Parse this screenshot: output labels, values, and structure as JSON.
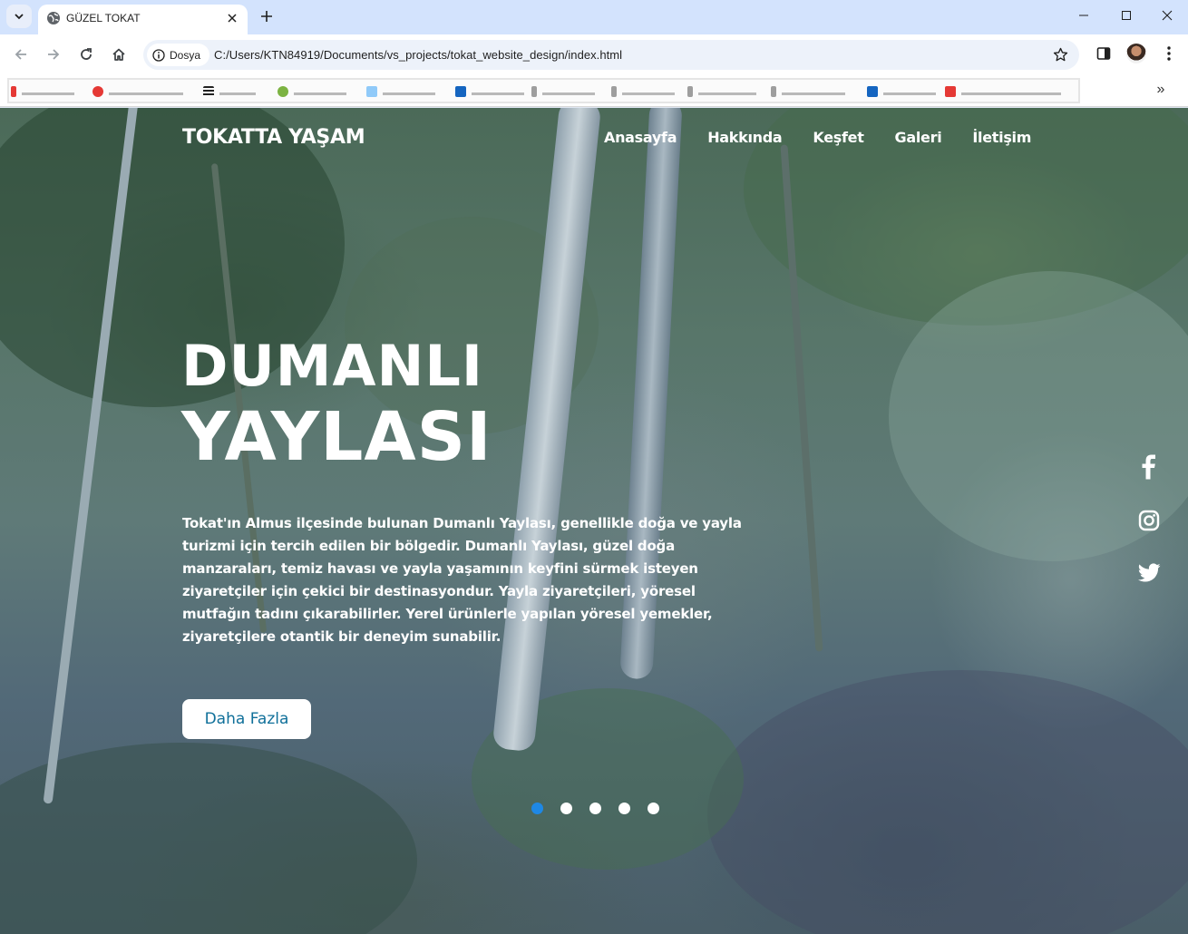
{
  "browser": {
    "tab_title": "GÜZEL TOKAT",
    "site_chip_label": "Dosya",
    "url": "C:/Users/KTN84919/Documents/vs_projects/tokat_website_design/index.html",
    "bookmarks_more": "»"
  },
  "site": {
    "logo": "TOKATTA YAŞAM",
    "nav": [
      "Anasayfa",
      "Hakkında",
      "Keşfet",
      "Galeri",
      "İletişim"
    ]
  },
  "hero": {
    "title_line1": "DUMANLI",
    "title_line2": "YAYLASI",
    "paragraph": "Tokat'ın Almus ilçesinde bulunan Dumanlı Yaylası, genellikle doğa ve yayla turizmi için tercih edilen bir bölgedir. Dumanlı Yaylası, güzel doğa manzaraları, temiz havası ve yayla yaşamının keyfini sürmek isteyen ziyaretçiler için çekici bir destinasyondur. Yayla ziyaretçileri, yöresel mutfağın tadını çıkarabilirler. Yerel ürünlerle yapılan yöresel yemekler, ziyaretçilere otantik bir deneyim sunabilir.",
    "cta_label": "Daha Fazla"
  },
  "social_icons": [
    "facebook-icon",
    "instagram-icon",
    "twitter-icon"
  ],
  "slider": {
    "count": 5,
    "active": 1,
    "active_color": "#1e88e5"
  },
  "colors": {
    "tab_strip": "#d3e3fd",
    "cta_text": "#10709a"
  }
}
